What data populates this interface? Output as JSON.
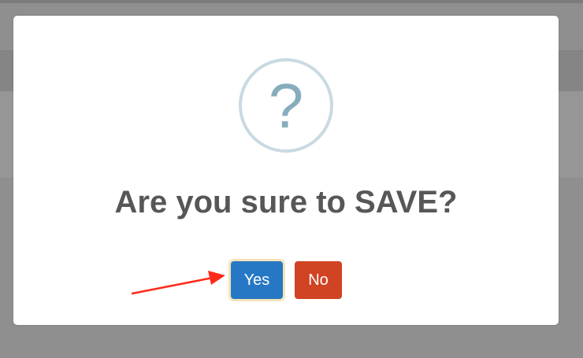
{
  "dialog": {
    "icon": "question-icon",
    "icon_glyph": "?",
    "title": "Are you sure to SAVE?",
    "confirm_label": "Yes",
    "cancel_label": "No"
  },
  "colors": {
    "confirm": "#2778c4",
    "cancel": "#d04323",
    "title_text": "#575757",
    "icon_ring": "#c9dae1",
    "icon_glyph": "#87adbd",
    "annotation_arrow": "#ff2a1a"
  },
  "annotation": {
    "type": "arrow",
    "target": "confirm-button"
  }
}
